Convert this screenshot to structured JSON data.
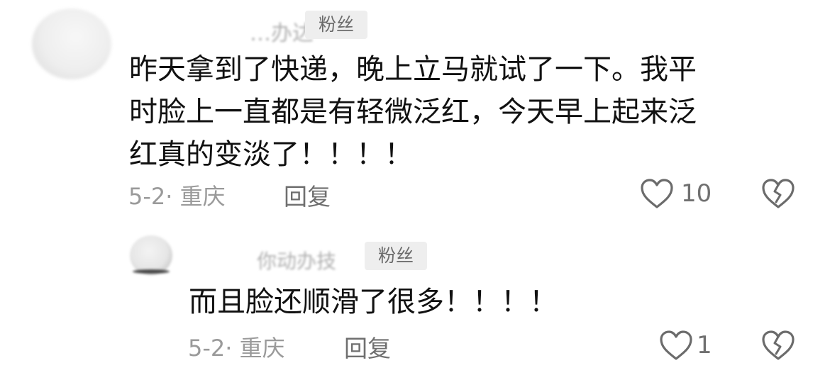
{
  "comments": [
    {
      "username": "…办达",
      "badge": "粉丝",
      "text_lines": [
        "昨天拿到了快递，晚上立马就试了一下。我平",
        "时脸上一直都是有轻微泛红，今天早上起来泛",
        "红真的变淡了！！！！"
      ],
      "meta": "5-2· 重庆",
      "reply_label": "回复",
      "likes": "10",
      "like_icon": "heart-outline-icon",
      "dislike_icon": "broken-heart-icon"
    },
    {
      "username": "你动办技",
      "badge": "粉丝",
      "text_lines": [
        "而且脸还顺滑了很多！！！！"
      ],
      "meta": "5-2· 重庆",
      "reply_label": "回复",
      "likes": "1",
      "like_icon": "heart-outline-icon",
      "dislike_icon": "broken-heart-icon"
    }
  ],
  "colors": {
    "text": "#111111",
    "meta": "#9a9a9a",
    "reply": "#6f6f6f",
    "badge_bg": "#eeeeee",
    "badge_text": "#6b6b6b",
    "icon": "#6b6b6b"
  }
}
